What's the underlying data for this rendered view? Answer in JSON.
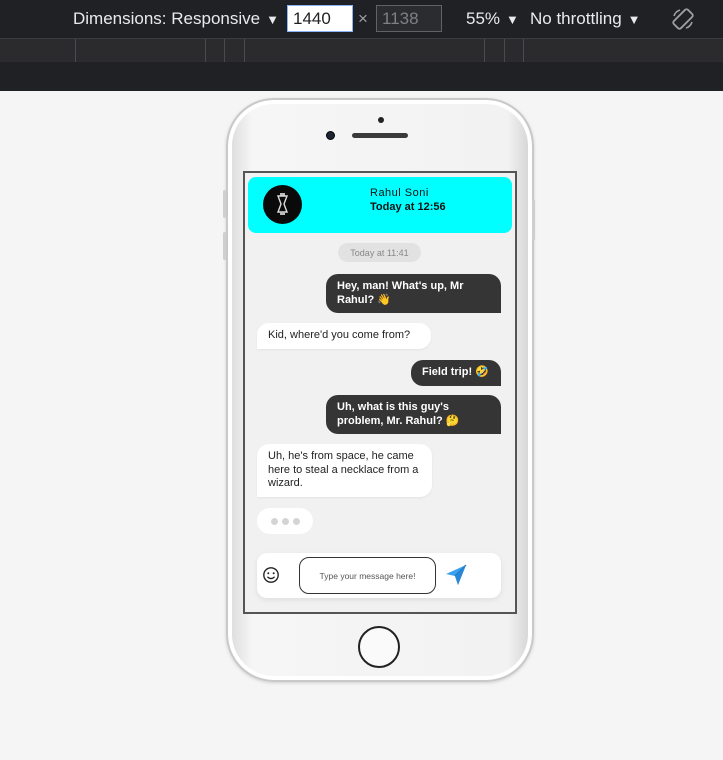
{
  "devtools": {
    "dimensions_label": "Dimensions: Responsive",
    "width_value": "1440",
    "height_value": "1138",
    "times_symbol": "×",
    "zoom_label": "55%",
    "throttling_label": "No throttling",
    "caret": "▼",
    "icons": {
      "rotate": "rotate-icon",
      "caret": "caret-down-icon"
    }
  },
  "chat": {
    "contact_name": "Rahul Soni",
    "contact_status": "Today at 12:56",
    "date_separator": "Today at 11:41",
    "header_color": "#00ffff",
    "outgoing_color": "#353535",
    "messages": [
      {
        "direction": "out",
        "text": "Hey, man! What's up, Mr Rahul? 👋"
      },
      {
        "direction": "in",
        "text": "Kid, where'd you come from?"
      },
      {
        "direction": "out",
        "text": "Field trip! 🤣"
      },
      {
        "direction": "out",
        "text": "Uh, what is this guy's problem, Mr. Rahul? 🤔"
      },
      {
        "direction": "in",
        "text": "Uh, he's from space, he came here to steal a necklace from a wizard."
      }
    ],
    "input_placeholder": "Type your message here!",
    "icons": {
      "emoji": "smiley-icon",
      "send": "paper-plane-icon",
      "avatar": "avatar-icon"
    }
  }
}
